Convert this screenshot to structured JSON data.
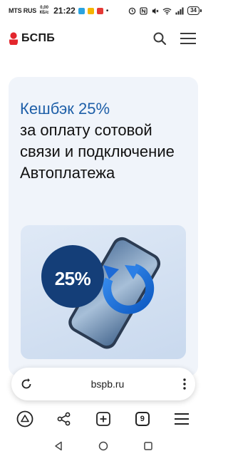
{
  "status_bar": {
    "carrier": "MTS RUS",
    "speed_value": "0,00",
    "speed_unit": "КБ/с",
    "time": "21:22",
    "battery": "34"
  },
  "site": {
    "logo_text": "БСПБ",
    "brand_color": "#e3262d"
  },
  "promo": {
    "title_accent": "Кешбэк 25%",
    "title_lines": "за оплату сотовой связи и подключение Автоплатежа",
    "badge_text": "25%",
    "accent_color": "#1e5fa8"
  },
  "browser": {
    "url": "bspb.ru",
    "tab_count": "9"
  }
}
